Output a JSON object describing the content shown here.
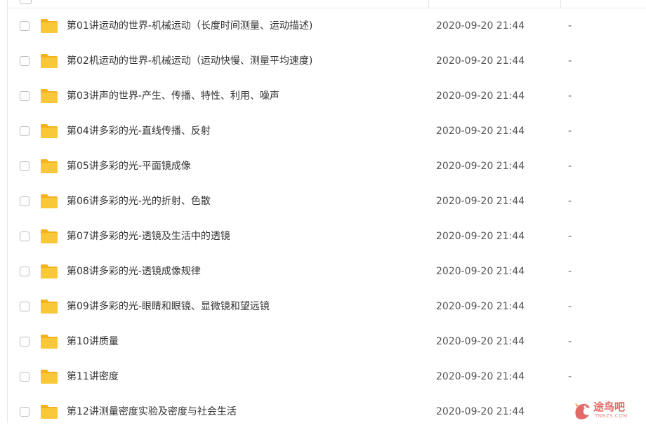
{
  "files": [
    {
      "name": "第01讲运动的世界-机械运动（长度时间测量、运动描述)",
      "modified": "2020-09-20 21:44",
      "size": "-"
    },
    {
      "name": "第02机运动的世界-机械运动（运动快慢、测量平均速度)",
      "modified": "2020-09-20 21:44",
      "size": "-"
    },
    {
      "name": "第03讲声的世界-产生、传播、特性、利用、噪声",
      "modified": "2020-09-20 21:44",
      "size": "-"
    },
    {
      "name": "第04讲多彩的光-直线传播、反射",
      "modified": "2020-09-20 21:44",
      "size": "-"
    },
    {
      "name": "第05讲多彩的光-平面镜成像",
      "modified": "2020-09-20 21:44",
      "size": "-"
    },
    {
      "name": "第06讲多彩的光-光的折射、色散",
      "modified": "2020-09-20 21:44",
      "size": "-"
    },
    {
      "name": "第07讲多彩的光-透镜及生活中的透镜",
      "modified": "2020-09-20 21:44",
      "size": "-"
    },
    {
      "name": "第08讲多彩的光-透镜成像规律",
      "modified": "2020-09-20 21:44",
      "size": "-"
    },
    {
      "name": "第09讲多彩的光-眼睛和眼镜、显微镜和望远镜",
      "modified": "2020-09-20 21:44",
      "size": "-"
    },
    {
      "name": "第10讲质量",
      "modified": "2020-09-20 21:44",
      "size": "-"
    },
    {
      "name": "第11讲密度",
      "modified": "2020-09-20 21:44",
      "size": "-"
    },
    {
      "name": "第12讲测量密度实验及密度与社会生活",
      "modified": "2020-09-20 21:44",
      "size": ""
    }
  ],
  "watermark": {
    "brand": "途鸟吧",
    "url": "TNBZS.COM"
  },
  "colors": {
    "folder": "#f9c73a",
    "folder_tab": "#f3b21f",
    "checkbox_border": "#bdbdbd",
    "watermark": "#e46a6a"
  },
  "icons": {
    "folder": "folder-icon",
    "checkbox": "checkbox-icon",
    "watermark_bird": "bird-logo-icon"
  }
}
